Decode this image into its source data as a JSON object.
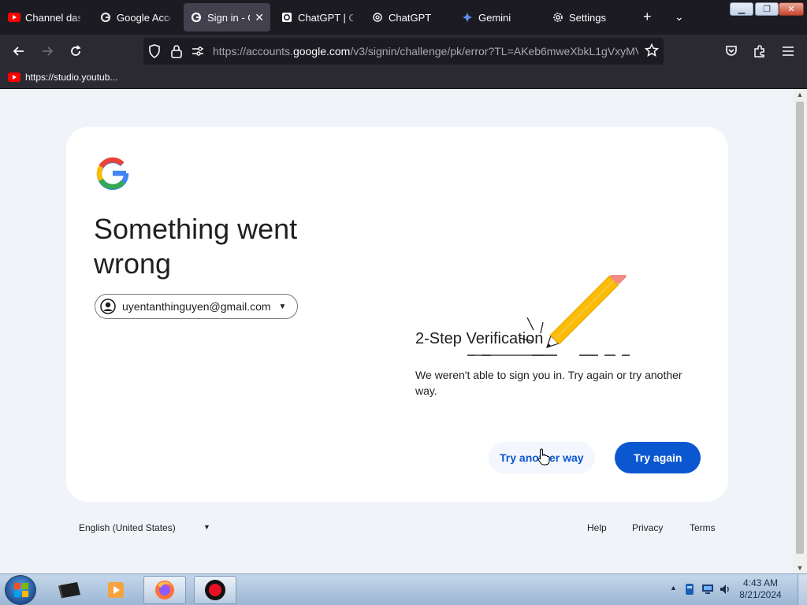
{
  "browser": {
    "tabs": [
      {
        "label": "Channel dash",
        "icon": "youtube-icon",
        "active": false
      },
      {
        "label": "Google Acco",
        "icon": "google-icon",
        "active": false
      },
      {
        "label": "Sign in - G",
        "icon": "google-icon",
        "active": true
      },
      {
        "label": "ChatGPT | Op",
        "icon": "chatgpt-icon",
        "active": false
      },
      {
        "label": "ChatGPT",
        "icon": "chatgpt-icon",
        "active": false
      },
      {
        "label": "Gemini",
        "icon": "gemini-icon",
        "active": false
      },
      {
        "label": "Settings",
        "icon": "gear-icon",
        "active": false
      }
    ],
    "url": {
      "prefix": "https://accounts.",
      "domain": "google.com",
      "path": "/v3/signin/challenge/pk/error?TL=AKeb6mweXbkL1gVxyMV"
    },
    "bookmarks": [
      {
        "label": "https://studio.youtub...",
        "icon": "youtube-icon"
      }
    ]
  },
  "page": {
    "heading": "Something went wrong",
    "account_email": "uyentanthinguyen@gmail.com",
    "subtitle": "2-Step Verification",
    "message": "We weren't able to sign you in. Try again or try another way.",
    "try_another_way_label": "Try another way",
    "try_again_label": "Try again",
    "footer": {
      "language": "English (United States)",
      "help": "Help",
      "privacy": "Privacy",
      "terms": "Terms"
    }
  },
  "colors": {
    "primary_button": "#0b57d0",
    "page_background": "#f0f4f9",
    "browser_chrome": "#1c1b22"
  },
  "taskbar": {
    "time": "4:43 AM",
    "date": "8/21/2024"
  }
}
